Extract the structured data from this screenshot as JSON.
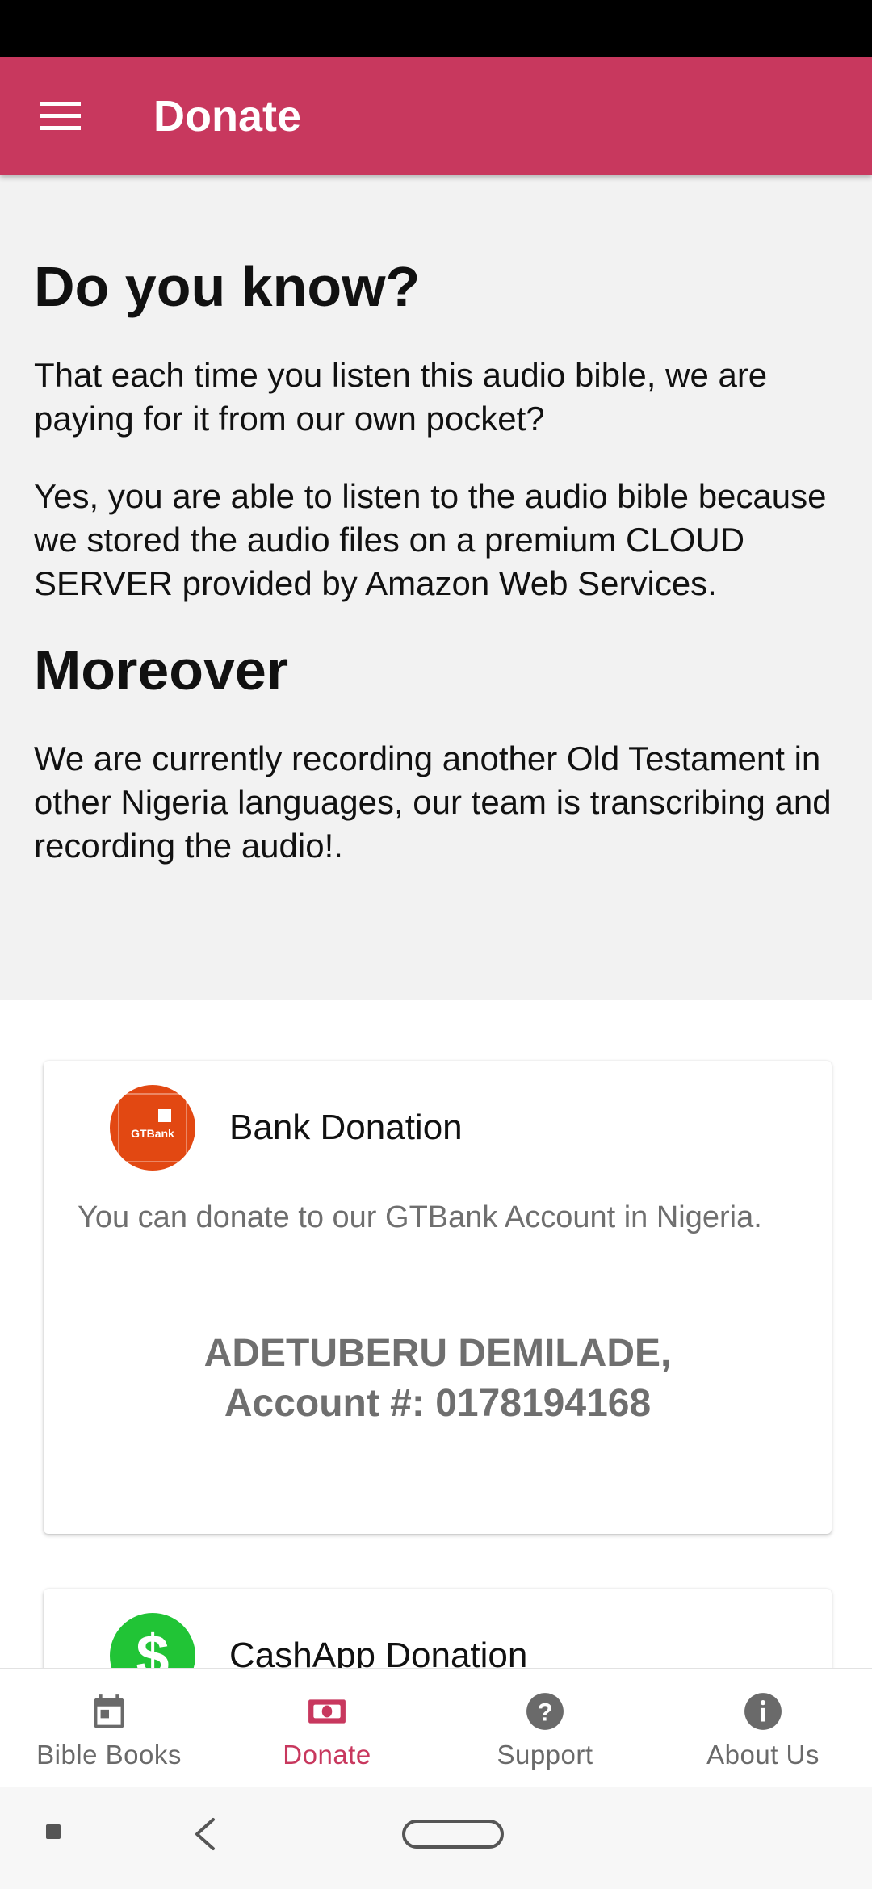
{
  "app_bar": {
    "title": "Donate",
    "menu_icon": "hamburger-menu-icon"
  },
  "intro": {
    "heading1": "Do you know?",
    "para1": "That each time you listen this audio bible, we are paying for it from our own pocket?",
    "para2": "Yes, you are able to listen to the audio bible because we stored the audio files on a premium CLOUD SERVER provided by Amazon Web Services.",
    "heading2": "Moreover",
    "para3": "We are currently recording another Old Testament in other Nigeria languages, our team is transcribing and recording the audio!."
  },
  "bank_card": {
    "logo_text": "GTBank",
    "title": "Bank Donation",
    "description": "You can donate to our GTBank Account in Nigeria.",
    "account_name": "ADETUBERU DEMILADE,",
    "account_number": "Account #: 0178194168",
    "logo_color": "#e24812"
  },
  "cashapp_card": {
    "logo_symbol": "$",
    "title": "CashApp Donation",
    "logo_color": "#21c436"
  },
  "bottom_nav": {
    "items": [
      {
        "label": "Bible Books",
        "icon": "calendar-icon",
        "active": false
      },
      {
        "label": "Donate",
        "icon": "money-icon",
        "active": true
      },
      {
        "label": "Support",
        "icon": "help-icon",
        "active": false
      },
      {
        "label": "About Us",
        "icon": "info-icon",
        "active": false
      }
    ]
  },
  "colors": {
    "primary": "#c8385e",
    "background": "#f2f2f2",
    "muted_text": "#6f6f6f"
  }
}
